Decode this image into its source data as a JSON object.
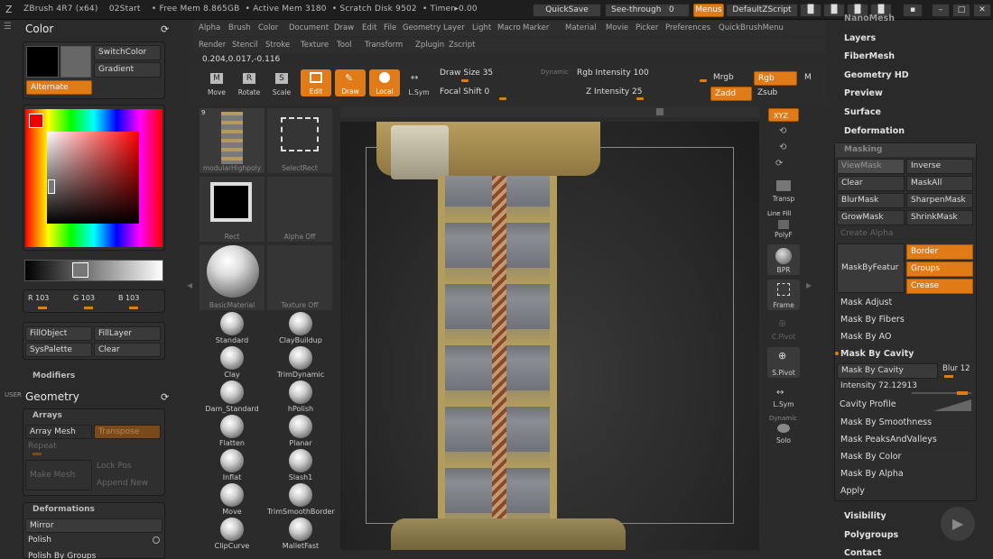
{
  "titlebar": {
    "app": "ZBrush 4R7 (x64)",
    "doc": "02Start",
    "free_mem": "• Free Mem 8.865GB",
    "active_mem": "• Active Mem 3180",
    "scratch": "• Scratch Disk 9502",
    "timer": "• Timer▸0.00",
    "quicksave": "QuickSave",
    "see_through": "See-through",
    "see_through_val": "0",
    "menus": "Menus",
    "default_script": "DefaultZScript"
  },
  "menu1": [
    "Alpha",
    "Brush",
    "Color",
    "Document",
    "Draw",
    "Edit",
    "File",
    "Geometry",
    "Layer",
    "Light",
    "Macro",
    "Marker",
    "Material",
    "Movie",
    "Picker",
    "Preferences",
    "QuickBrushMenu"
  ],
  "menu2": [
    "Render",
    "Stencil",
    "Stroke",
    "Texture",
    "Tool",
    "Transform",
    "Zplugin",
    "Zscript"
  ],
  "coords": "0.204,0.017,-0.116",
  "toolbar": {
    "move": "Move",
    "rotate": "Rotate",
    "scale": "Scale",
    "edit": "Edit",
    "draw": "Draw",
    "local": "Local",
    "lsym": "L.Sym",
    "draw_size": "Draw Size 35",
    "dynamic": "Dynamic",
    "focal_shift": "Focal Shift 0",
    "rgb_intensity": "Rgb Intensity 100",
    "z_intensity": "Z Intensity 25",
    "mrgb": "Mrgb",
    "rgb": "Rgb",
    "m": "M",
    "zadd": "Zadd",
    "zsub": "Zsub"
  },
  "color_panel": {
    "title": "Color",
    "switch_color": "SwitchColor",
    "gradient": "Gradient",
    "alternate": "Alternate",
    "r": "R 103",
    "g": "G 103",
    "b": "B 103",
    "fill_object": "FillObject",
    "fill_layer": "FillLayer",
    "sys_palette": "SysPalette",
    "clear": "Clear",
    "modifiers": "Modifiers"
  },
  "geometry_panel": {
    "user": "USER",
    "title": "Geometry",
    "arrays": "Arrays",
    "array_mesh": "Array Mesh",
    "transpose": "Transpose",
    "repeat": "Repeat",
    "make_mesh": "Make Mesh",
    "lock_pos": "Lock Pos",
    "append_new": "Append New",
    "deformations": "Deformations",
    "mirror": "Mirror",
    "polish": "Polish",
    "polish_by_groups": "Polish By Groups"
  },
  "tool_palette": {
    "thumb1": "modularHighpoly",
    "thumb1_count": "9",
    "thumb2": "SelectRect",
    "thumb3": "Rect",
    "thumb4": "Alpha Off",
    "thumb5": "BasicMaterial",
    "thumb6": "Texture Off"
  },
  "brushes": [
    [
      "Standard",
      "ClayBuildup"
    ],
    [
      "Clay",
      "TrimDynamic"
    ],
    [
      "Dam_Standard",
      "hPolish"
    ],
    [
      "Flatten",
      "Planar"
    ],
    [
      "Inflat",
      "Slash1"
    ],
    [
      "Move",
      "TrimSmoothBorder"
    ],
    [
      "ClipCurve",
      "MalletFast"
    ]
  ],
  "side_tools": {
    "xyz": "XYZ",
    "transp": "Transp",
    "line_fill": "Line Fill",
    "polyf": "PolyF",
    "bpr": "BPR",
    "frame": "Frame",
    "cpivot": "C.Pivot",
    "spivot": "S.Pivot",
    "lsym": "L.Sym",
    "dynamic": "Dynamic",
    "solo": "Solo"
  },
  "right_panel": {
    "nano_mesh": "NanoMesh",
    "layers": "Layers",
    "fiber_mesh": "FiberMesh",
    "geometry_hd": "Geometry HD",
    "preview": "Preview",
    "surface": "Surface",
    "deformation": "Deformation",
    "masking": "Masking",
    "view_mask": "ViewMask",
    "inverse": "Inverse",
    "clear": "Clear",
    "mask_all": "MaskAll",
    "blur_mask": "BlurMask",
    "sharpen_mask": "SharpenMask",
    "grow_mask": "GrowMask",
    "shrink_mask": "ShrinkMask",
    "create_alpha": "Create Alpha",
    "mask_by_feature": "MaskByFeatur",
    "border": "Border",
    "groups": "Groups",
    "crease": "Crease",
    "mask_adjust": "Mask Adjust",
    "mask_by_fibers": "Mask By Fibers",
    "mask_by_ao": "Mask By AO",
    "mask_by_cavity_header": "Mask By Cavity",
    "mask_by_cavity_btn": "Mask By Cavity",
    "blur": "Blur 12",
    "intensity": "Intensity 72.12913",
    "cavity_profile": "Cavity Profile",
    "mask_by_smoothness": "Mask By Smoothness",
    "mask_peaks": "Mask PeaksAndValleys",
    "mask_by_color": "Mask By Color",
    "mask_by_alpha": "Mask By Alpha",
    "apply": "Apply",
    "visibility": "Visibility",
    "polygroups": "Polygroups",
    "contact": "Contact"
  },
  "colors": {
    "accent": "#e07b18",
    "main_color": "#676767",
    "secondary_color": "#000000"
  }
}
